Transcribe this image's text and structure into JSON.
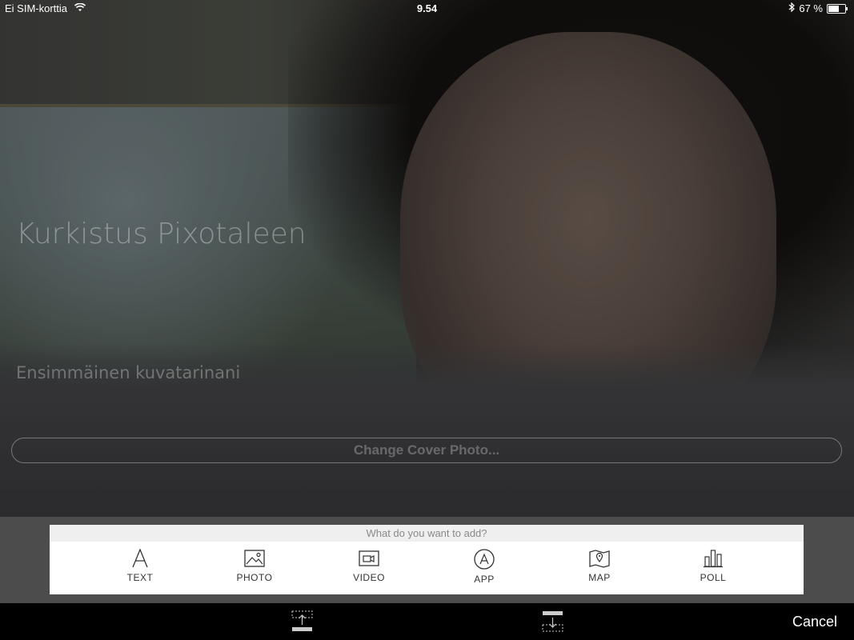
{
  "status_bar": {
    "carrier": "Ei SIM-korttia",
    "time": "9.54",
    "battery_percent": "67 %",
    "battery_level": 0.67
  },
  "cover": {
    "title": "Kurkistus Pixotaleen",
    "subtitle": "Ensimmäinen kuvatarinani",
    "change_cover_label": "Change Cover Photo..."
  },
  "add_panel": {
    "prompt": "What do you want to add?",
    "options": [
      {
        "label": "TEXT",
        "icon": "text-icon"
      },
      {
        "label": "PHOTO",
        "icon": "photo-icon"
      },
      {
        "label": "VIDEO",
        "icon": "video-icon"
      },
      {
        "label": "APP",
        "icon": "app-icon"
      },
      {
        "label": "MAP",
        "icon": "map-icon"
      },
      {
        "label": "POLL",
        "icon": "poll-icon"
      }
    ]
  },
  "bottom_bar": {
    "cancel_label": "Cancel",
    "left_icon": "insert-above-icon",
    "right_icon": "insert-below-icon"
  }
}
